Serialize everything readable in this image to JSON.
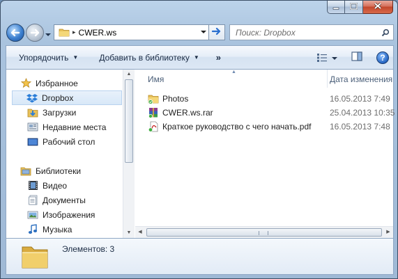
{
  "window": {
    "caption_buttons": {
      "minimize": "minimize-icon",
      "maximize": "maximize-icon",
      "close": "close-icon"
    }
  },
  "address": {
    "path": "CWER.ws",
    "search_placeholder": "Поиск: Dropbox"
  },
  "commandbar": {
    "organize": "Упорядочить",
    "add_to_library": "Добавить в библиотеку",
    "more": "»"
  },
  "navpane": {
    "favorites_header": "Избранное",
    "favorites": [
      {
        "label": "Dropbox",
        "icon": "dropbox-icon",
        "selected": true
      },
      {
        "label": "Загрузки",
        "icon": "downloads-icon"
      },
      {
        "label": "Недавние места",
        "icon": "recent-places-icon"
      },
      {
        "label": "Рабочий стол",
        "icon": "desktop-icon"
      }
    ],
    "libraries_header": "Библиотеки",
    "libraries": [
      {
        "label": "Видео",
        "icon": "video-library-icon"
      },
      {
        "label": "Документы",
        "icon": "documents-library-icon"
      },
      {
        "label": "Изображения",
        "icon": "pictures-library-icon"
      },
      {
        "label": "Музыка",
        "icon": "music-library-icon"
      }
    ]
  },
  "filelist": {
    "columns": {
      "name": "Имя",
      "date": "Дата изменения"
    },
    "rows": [
      {
        "name": "Photos",
        "date": "16.05.2013 7:49",
        "icon": "synced-folder-icon"
      },
      {
        "name": "CWER.ws.rar",
        "date": "25.04.2013 10:35",
        "icon": "rar-archive-icon"
      },
      {
        "name": "Краткое руководство с чего начать.pdf",
        "date": "16.05.2013 7:48",
        "icon": "pdf-file-icon"
      }
    ]
  },
  "details": {
    "item_count": "Элементов: 3"
  },
  "colors": {
    "title_glass": "#bcd3ea",
    "selection": "#d8e8f8",
    "close_button": "#c2462c",
    "dropbox_blue": "#2a7dd8"
  }
}
